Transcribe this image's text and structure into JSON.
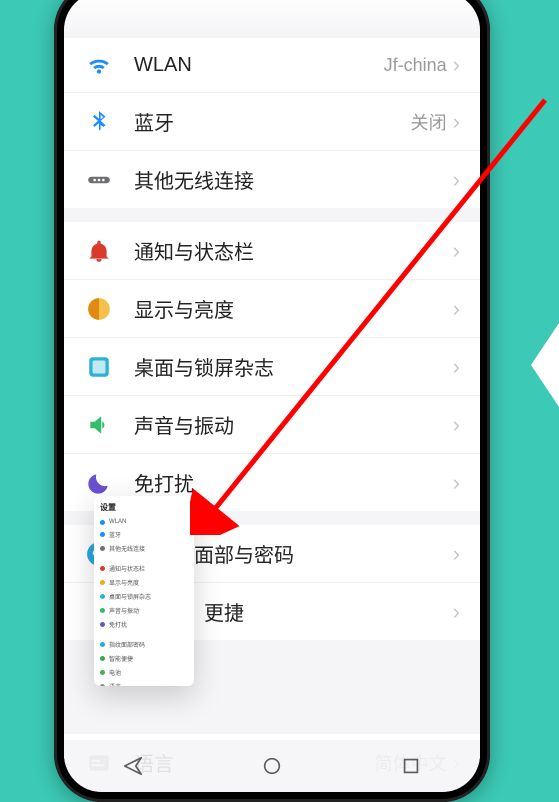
{
  "page_title": "设置",
  "groups": [
    {
      "rows": [
        {
          "id": "wlan",
          "icon": "wifi-icon",
          "color": "#1a8cff",
          "label": "WLAN",
          "value": "Jf-china"
        },
        {
          "id": "bluetooth",
          "icon": "bluetooth-icon",
          "color": "#1a8cff",
          "label": "蓝牙",
          "value": "关闭"
        },
        {
          "id": "other-wireless",
          "icon": "dots-icon",
          "color": "#6e6e73",
          "label": "其他无线连接",
          "value": ""
        }
      ]
    },
    {
      "rows": [
        {
          "id": "notifications",
          "icon": "bell-icon",
          "color": "#d93a2b",
          "label": "通知与状态栏",
          "value": ""
        },
        {
          "id": "display",
          "icon": "brightness-icon",
          "color": "#f5a623",
          "label": "显示与亮度",
          "value": ""
        },
        {
          "id": "home-lock",
          "icon": "wallpaper-icon",
          "color": "#2bb3d6",
          "label": "桌面与锁屏杂志",
          "value": ""
        },
        {
          "id": "sound",
          "icon": "speaker-icon",
          "color": "#2fbf6b",
          "label": "声音与振动",
          "value": ""
        },
        {
          "id": "dnd",
          "icon": "moon-icon",
          "color": "#6a4fcf",
          "label": "免打扰",
          "value": ""
        }
      ]
    },
    {
      "rows": [
        {
          "id": "biometrics",
          "icon": "fingerprint-icon",
          "color": "#2aa7e0",
          "label": "指纹、面部与密码",
          "value": ""
        },
        {
          "id": "convenience",
          "icon": "",
          "color": "",
          "label": "更捷",
          "value": ""
        }
      ]
    },
    {
      "rows": [
        {
          "id": "language",
          "icon": "lang-icon",
          "color": "#8e8e93",
          "label": "语言",
          "value": "简体中文"
        }
      ]
    }
  ],
  "mini_preview": {
    "title": "设置",
    "rows": [
      {
        "label": "WLAN",
        "color": "#1a8cff"
      },
      {
        "label": "蓝牙",
        "color": "#1a8cff"
      },
      {
        "label": "其他无线连接",
        "color": "#6e6e73"
      },
      {
        "label": "通知与状态栏",
        "color": "#d93a2b"
      },
      {
        "label": "显示与亮度",
        "color": "#f5a623"
      },
      {
        "label": "桌面与锁屏杂志",
        "color": "#2bb3d6"
      },
      {
        "label": "声音与振动",
        "color": "#2fbf6b"
      },
      {
        "label": "免打扰",
        "color": "#6a4fcf"
      },
      {
        "label": "指纹面部密码",
        "color": "#2aa7e0"
      },
      {
        "label": "智能便捷",
        "color": "#35a853"
      },
      {
        "label": "电池",
        "color": "#4caf50"
      },
      {
        "label": "语言",
        "color": "#8e8e93"
      }
    ]
  },
  "annotation": {
    "arrow_color": "#ff0000"
  }
}
